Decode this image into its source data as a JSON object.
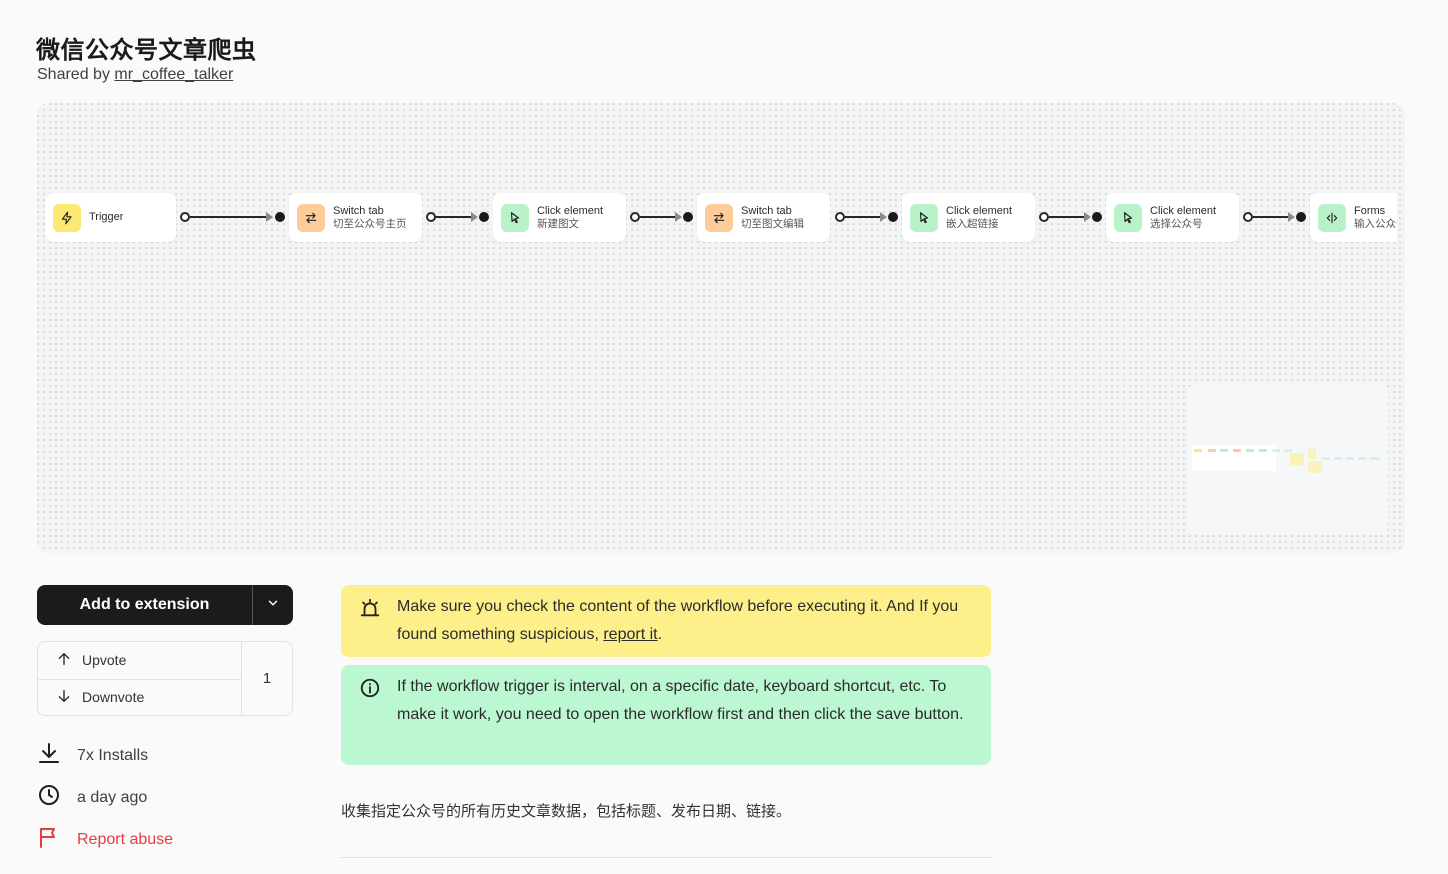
{
  "page": {
    "title": "微信公众号文章爬虫",
    "shared_prefix": "Shared by",
    "author": "mr_coffee_talker"
  },
  "workflow": {
    "nodes": [
      {
        "title": "Trigger",
        "subtitle": "",
        "icon": "lightning-icon",
        "color": "#fde971"
      },
      {
        "title": "Switch tab",
        "subtitle": "切至公众号主页",
        "icon": "switch-arrows-icon",
        "color": "#fdcc99"
      },
      {
        "title": "Click element",
        "subtitle": "新建图文",
        "icon": "cursor-click-icon",
        "color": "#b9f2c9"
      },
      {
        "title": "Switch tab",
        "subtitle": "切至图文编辑",
        "icon": "switch-arrows-icon",
        "color": "#fdcc99"
      },
      {
        "title": "Click element",
        "subtitle": "嵌入超链接",
        "icon": "cursor-click-icon",
        "color": "#b9f2c9"
      },
      {
        "title": "Click element",
        "subtitle": "选择公众号",
        "icon": "cursor-click-icon",
        "color": "#b9f2c9"
      },
      {
        "title": "Forms",
        "subtitle": "输入公众号",
        "icon": "text-cursor-icon",
        "color": "#b9f2c9"
      }
    ]
  },
  "actions": {
    "add_label": "Add to extension",
    "upvote_label": "Upvote",
    "downvote_label": "Downvote",
    "vote_count": "1",
    "installs": "7x Installs",
    "updated": "a day ago",
    "report_label": "Report abuse"
  },
  "alerts": {
    "warning_text": "Make sure you check the content of the workflow before executing it. And If you found something suspicious, ",
    "warning_link": "report it",
    "warning_end": ".",
    "info_text": "If the workflow trigger is interval, on a specific date, keyboard shortcut, etc. To make it work, you need to open the workflow first and then click the save button."
  },
  "description": "收集指定公众号的所有历史文章数据，包括标题、发布日期、链接。",
  "colors": {
    "warning_bg": "#fdf08a",
    "info_bg": "#bbf7d0",
    "danger": "#e53e3e",
    "primary_button": "#1b1b1b"
  }
}
